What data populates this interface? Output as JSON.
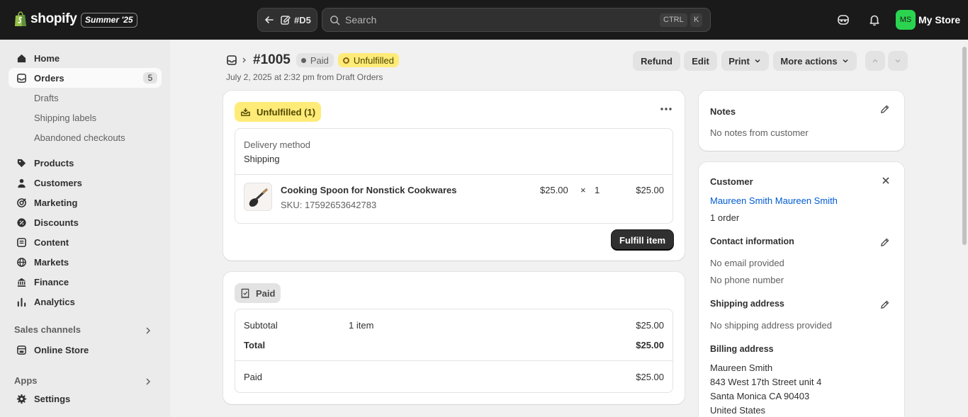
{
  "topbar": {
    "brand": "shopify",
    "edition": "Summer '25",
    "back_label": "#D5",
    "search_placeholder": "Search",
    "kbd_ctrl": "CTRL",
    "kbd_k": "K",
    "avatar_initials": "MS",
    "store_name": "My Store"
  },
  "sidebar": {
    "home": "Home",
    "orders": "Orders",
    "orders_count": "5",
    "drafts": "Drafts",
    "shipping_labels": "Shipping labels",
    "abandoned": "Abandoned checkouts",
    "products": "Products",
    "customers": "Customers",
    "marketing": "Marketing",
    "discounts": "Discounts",
    "content": "Content",
    "markets": "Markets",
    "finance": "Finance",
    "analytics": "Analytics",
    "sales_channels": "Sales channels",
    "online_store": "Online Store",
    "apps": "Apps",
    "settings": "Settings"
  },
  "order": {
    "number": "#1005",
    "payment_badge": "Paid",
    "fulfillment_badge": "Unfulfilled",
    "subtitle": "July 2, 2025 at 2:32 pm from Draft Orders",
    "actions": {
      "refund": "Refund",
      "edit": "Edit",
      "print": "Print",
      "more": "More actions"
    }
  },
  "fulfillment": {
    "tag": "Unfulfilled (1)",
    "delivery_label": "Delivery method",
    "delivery_value": "Shipping",
    "item_name": "Cooking Spoon for Nonstick Cookwares",
    "sku": "SKU: 17592653642783",
    "price": "$25.00",
    "times": "×",
    "qty": "1",
    "total": "$25.00",
    "fulfill_button": "Fulfill item"
  },
  "payment": {
    "tag": "Paid",
    "subtotal_label": "Subtotal",
    "subtotal_items": "1 item",
    "subtotal_value": "$25.00",
    "total_label": "Total",
    "total_value": "$25.00",
    "paid_label": "Paid",
    "paid_value": "$25.00"
  },
  "notes": {
    "title": "Notes",
    "text": "No notes from customer"
  },
  "customer": {
    "title": "Customer",
    "name": "Maureen Smith Maureen Smith",
    "orders": "1 order",
    "contact_title": "Contact information",
    "email": "No email provided",
    "phone": "No phone number",
    "shipping_title": "Shipping address",
    "shipping_text": "No shipping address provided",
    "billing_title": "Billing address",
    "billing_line1": "Maureen Smith",
    "billing_line2": "843 West 17th Street unit 4",
    "billing_line3": "Santa Monica CA 90403",
    "billing_line4": "United States"
  },
  "colors": {
    "topbar": "#1a1a1a",
    "accent_link": "#005bd3",
    "unfulfilled_yellow": "#ffeb78",
    "avatar_green": "#2ad44f"
  }
}
